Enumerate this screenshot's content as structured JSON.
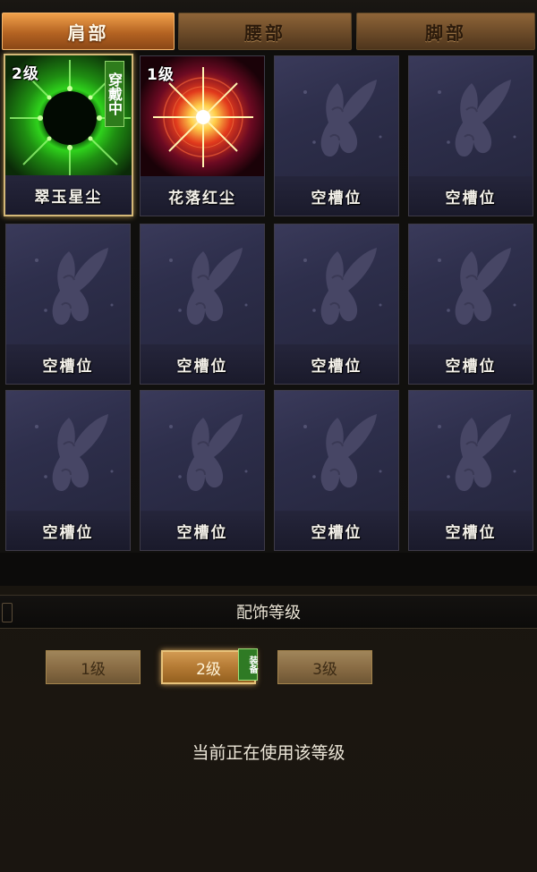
{
  "tabs": [
    {
      "label": "肩部",
      "active": true
    },
    {
      "label": "腰部",
      "active": false
    },
    {
      "label": "脚部",
      "active": false
    }
  ],
  "slots": [
    {
      "name": "翠玉星尘",
      "level": "2级",
      "wearing": "穿戴中",
      "art": "green-burst-icon"
    },
    {
      "name": "花落红尘",
      "level": "1级",
      "art": "red-star-icon"
    },
    {
      "name": "空槽位",
      "art": "butterfly-icon"
    },
    {
      "name": "空槽位",
      "art": "butterfly-icon"
    },
    {
      "name": "空槽位",
      "art": "butterfly-icon"
    },
    {
      "name": "空槽位",
      "art": "butterfly-icon"
    },
    {
      "name": "空槽位",
      "art": "butterfly-icon"
    },
    {
      "name": "空槽位",
      "art": "butterfly-icon"
    },
    {
      "name": "空槽位",
      "art": "butterfly-icon"
    },
    {
      "name": "空槽位",
      "art": "butterfly-icon"
    },
    {
      "name": "空槽位",
      "art": "butterfly-icon"
    },
    {
      "name": "空槽位",
      "art": "butterfly-icon"
    }
  ],
  "level_section": {
    "title": "配饰等级",
    "buttons": [
      {
        "label": "1级",
        "active": false
      },
      {
        "label": "2级",
        "active": true
      },
      {
        "label": "3级",
        "active": false
      }
    ],
    "equip_tag": "装备",
    "status": "当前正在使用该等级"
  },
  "colors": {
    "tab_active": "#b46322",
    "selected_border": "#d4b878",
    "wear_badge": "#2e7c1c",
    "slot_bg": "#2e2f4c"
  }
}
